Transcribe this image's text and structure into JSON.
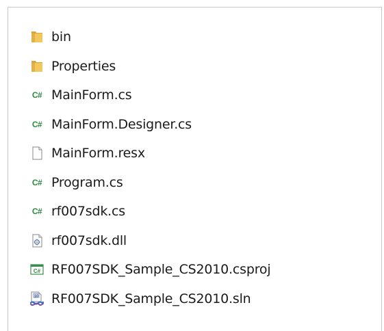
{
  "files": [
    {
      "name": "bin",
      "icon": "folder-icon"
    },
    {
      "name": "Properties",
      "icon": "folder-icon"
    },
    {
      "name": "MainForm.cs",
      "icon": "csharp-file-icon"
    },
    {
      "name": "MainForm.Designer.cs",
      "icon": "csharp-file-icon"
    },
    {
      "name": "MainForm.resx",
      "icon": "blank-file-icon"
    },
    {
      "name": "Program.cs",
      "icon": "csharp-file-icon"
    },
    {
      "name": "rf007sdk.cs",
      "icon": "csharp-file-icon"
    },
    {
      "name": "rf007sdk.dll",
      "icon": "dll-file-icon"
    },
    {
      "name": "RF007SDK_Sample_CS2010.csproj",
      "icon": "csproj-file-icon"
    },
    {
      "name": "RF007SDK_Sample_CS2010.sln",
      "icon": "sln-file-icon"
    }
  ],
  "icon_labels": {
    "csharp": "C#",
    "csproj": "C#",
    "sln": "10"
  },
  "colors": {
    "folder": "#e8b84a",
    "csharp": "#2e8b3e",
    "sln_blue": "#2d6fcf",
    "sln_purple": "#7a4fa8"
  }
}
